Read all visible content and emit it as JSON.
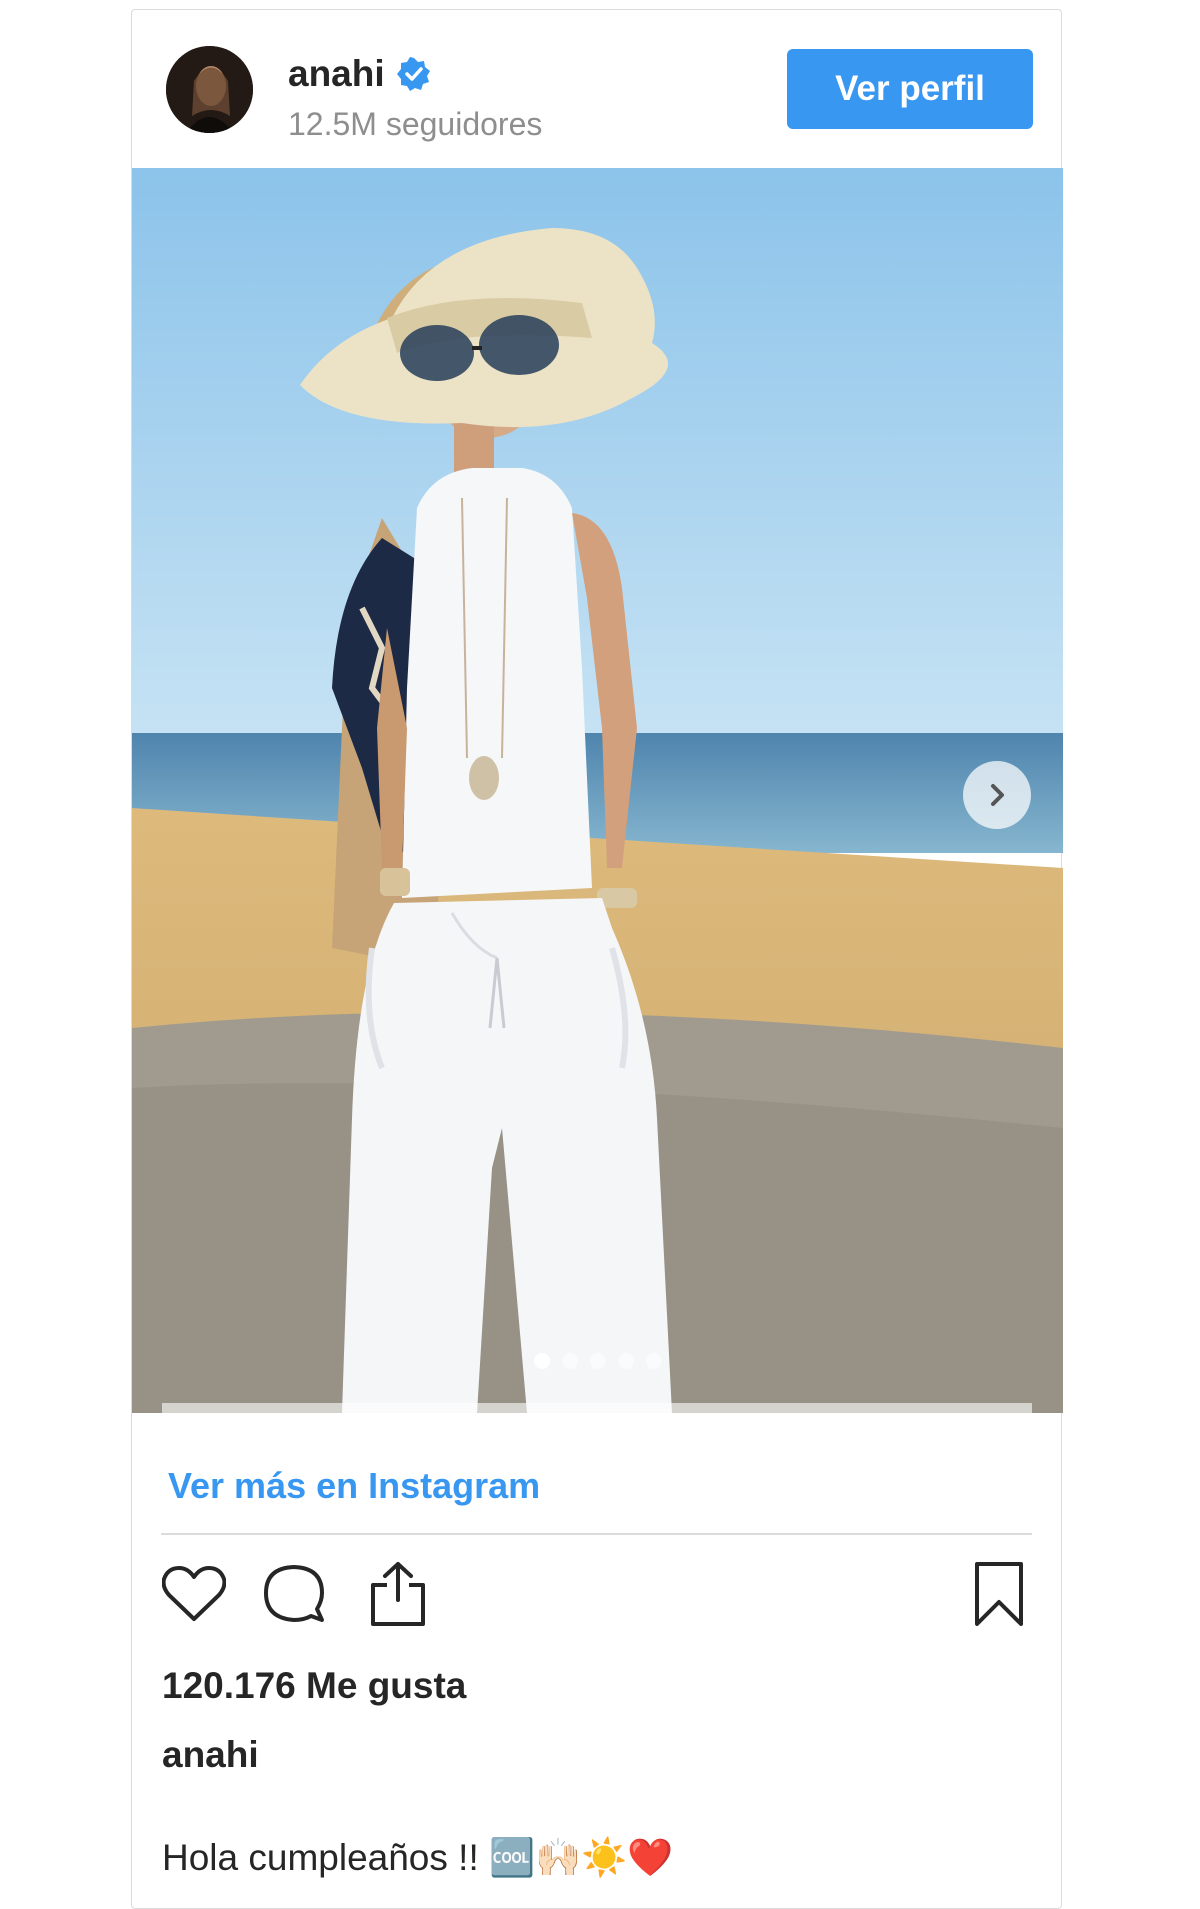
{
  "header": {
    "username": "anahi",
    "followers": "12.5M seguidores",
    "verified_icon": "verified-badge-icon",
    "view_profile_label": "Ver perfil"
  },
  "media": {
    "next_icon": "chevron-right-icon",
    "carousel_count": 5,
    "carousel_active_index": 0
  },
  "footer": {
    "more_link": "Ver más en Instagram",
    "icons": [
      "heart-icon",
      "comment-icon",
      "share-icon",
      "bookmark-icon"
    ],
    "likes": "120.176 Me gusta",
    "caption_user": "anahi",
    "caption_text": "Hola cumpleaños !! 🆒🙌🏻☀️❤️"
  },
  "colors": {
    "accent": "#3897f0",
    "text": "#262626",
    "muted": "#8e8e8e",
    "border": "#dbdbdb"
  }
}
